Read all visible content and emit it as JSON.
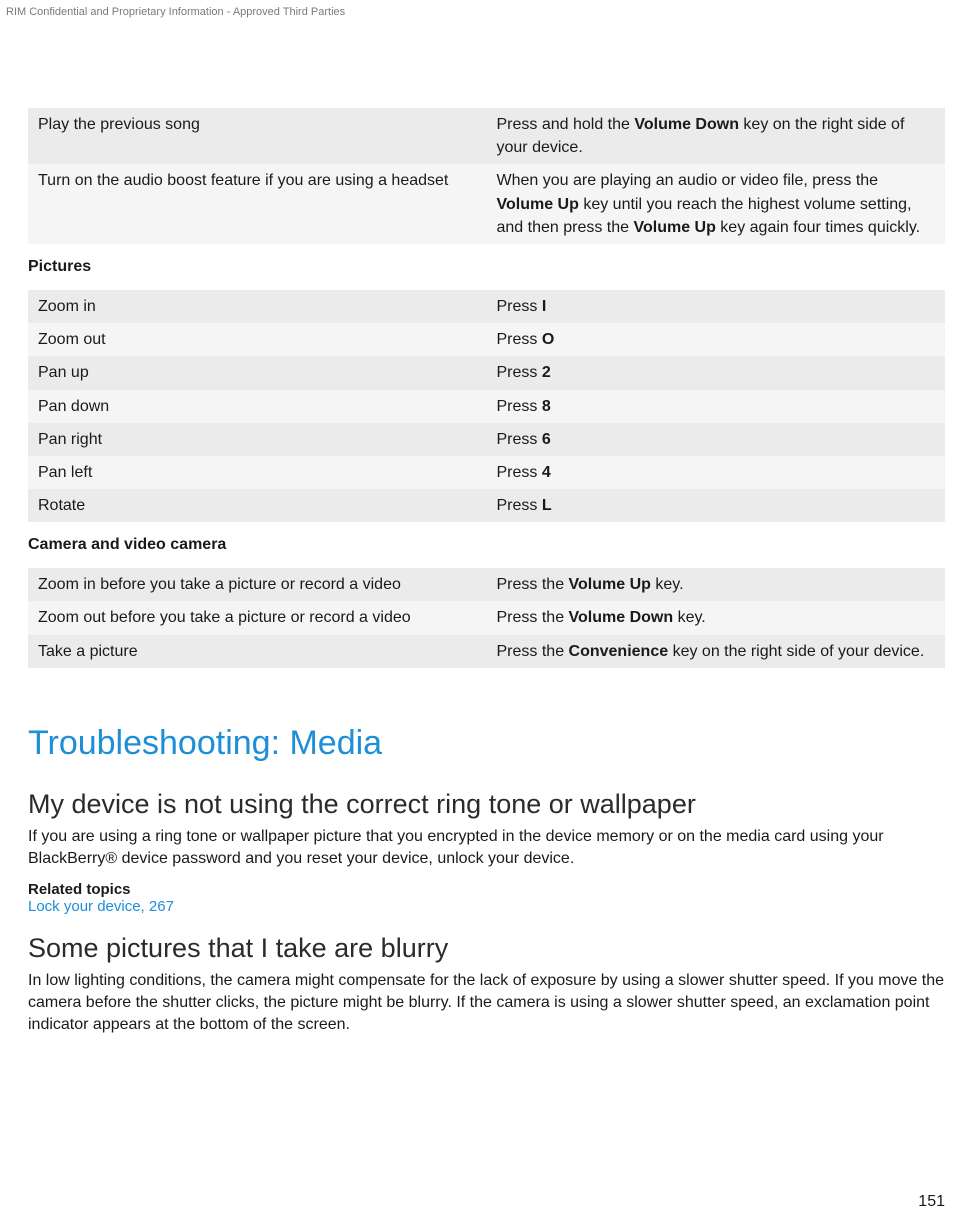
{
  "header_note": "RIM Confidential and Proprietary Information - Approved Third Parties",
  "page_number": "151",
  "table1": {
    "rows": [
      {
        "action": "Play the previous song",
        "instr_pre": "Press and hold the ",
        "instr_b1": "Volume Down",
        "instr_post": " key on the right side of your device."
      },
      {
        "action": "Turn on the audio boost feature if you are using a headset",
        "instr_pre": "When you are playing an audio or video file, press the ",
        "instr_b1": "Volume Up",
        "instr_mid": " key until you reach the highest volume setting, and then press the ",
        "instr_b2": "Volume Up",
        "instr_post": " key again four times quickly."
      }
    ]
  },
  "pictures_heading": "Pictures",
  "table2": {
    "rows": [
      {
        "action": "Zoom in",
        "instr_pre": "Press ",
        "instr_b1": "I",
        "instr_post": ""
      },
      {
        "action": "Zoom out",
        "instr_pre": "Press ",
        "instr_b1": "O",
        "instr_post": ""
      },
      {
        "action": "Pan up",
        "instr_pre": "Press ",
        "instr_b1": "2",
        "instr_post": ""
      },
      {
        "action": "Pan down",
        "instr_pre": "Press ",
        "instr_b1": "8",
        "instr_post": ""
      },
      {
        "action": "Pan right",
        "instr_pre": "Press ",
        "instr_b1": "6",
        "instr_post": ""
      },
      {
        "action": "Pan left",
        "instr_pre": "Press ",
        "instr_b1": "4",
        "instr_post": ""
      },
      {
        "action": "Rotate",
        "instr_pre": "Press ",
        "instr_b1": "L",
        "instr_post": ""
      }
    ]
  },
  "camera_heading": "Camera and video camera",
  "table3": {
    "rows": [
      {
        "action": "Zoom in before you take a picture or record a video",
        "instr_pre": "Press the ",
        "instr_b1": "Volume Up",
        "instr_post": " key."
      },
      {
        "action": "Zoom out before you take a picture or record a video",
        "instr_pre": "Press the ",
        "instr_b1": "Volume Down",
        "instr_post": " key."
      },
      {
        "action": "Take a picture",
        "instr_pre": "Press the ",
        "instr_b1": "Convenience",
        "instr_post": " key on the right side of your device."
      }
    ]
  },
  "section_heading": "Troubleshooting: Media",
  "topic1": {
    "heading": "My device is not using the correct ring tone or wallpaper",
    "body": "If you are using a ring tone or wallpaper picture that you encrypted in the device memory or on the media card using your BlackBerry® device password and you reset your device, unlock your device.",
    "related_label": "Related topics",
    "related_link": "Lock your device, 267"
  },
  "topic2": {
    "heading": "Some pictures that I take are blurry",
    "body": "In low lighting conditions, the camera might compensate for the lack of exposure by using a slower shutter speed. If you move the camera before the shutter clicks, the picture might be blurry. If the camera is using a slower shutter speed, an exclamation point indicator appears at the bottom of the screen."
  }
}
